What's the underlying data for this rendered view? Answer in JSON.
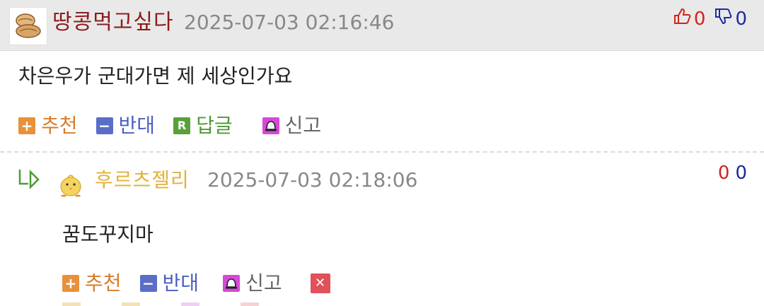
{
  "main_comment": {
    "username": "땅콩먹고싶다",
    "timestamp": "2025-07-03 02:16:46",
    "likes": "0",
    "dislikes": "0",
    "body": "차은우가 군대가면 제 세상인가요",
    "actions": {
      "recommend": "추천",
      "oppose": "반대",
      "reply": "답글",
      "report": "신고"
    }
  },
  "reply_comment": {
    "username": "후르츠젤리",
    "timestamp": "2025-07-03 02:18:06",
    "likes": "0",
    "dislikes": "0",
    "body": "꿈도꾸지마",
    "actions": {
      "recommend": "추천",
      "oppose": "반대",
      "report": "신고"
    }
  },
  "badges": {
    "plus": "+",
    "minus": "−",
    "reply": "R",
    "delete": "✕"
  },
  "icons": [
    "peanut-avatar-icon",
    "thumbs-up-icon",
    "thumbs-down-icon",
    "reply-arrow-icon",
    "chick-avatar-icon",
    "report-bell-icon",
    "delete-icon"
  ],
  "colors": {
    "username_main": "#8c1d1d",
    "username_reply": "#e2b23a",
    "like": "#d0241c",
    "dislike": "#1b2aa0",
    "recommend": "#d97c2b",
    "oppose": "#4b5fc0",
    "reply": "#4f9a34"
  }
}
